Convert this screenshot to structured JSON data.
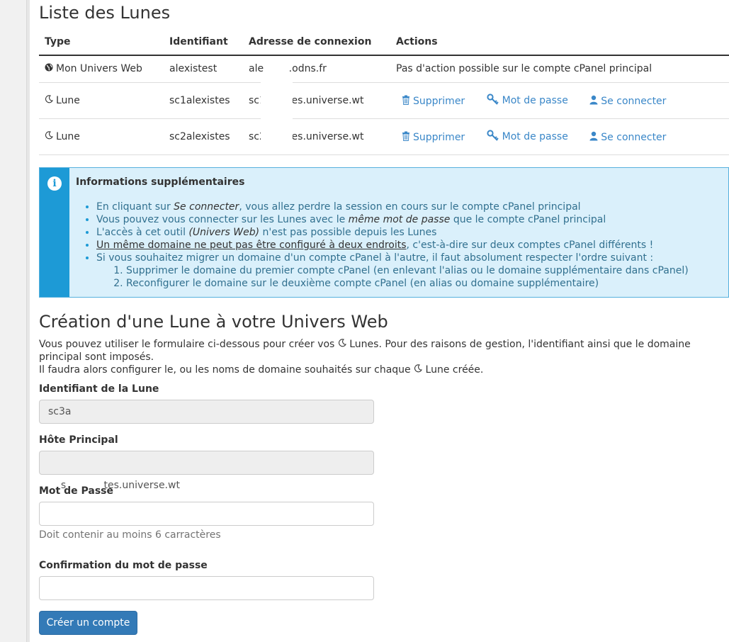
{
  "page": {
    "title": "Liste des Lunes"
  },
  "table": {
    "headers": [
      "Type",
      "Identifiant",
      "Adresse de connexion",
      "Actions"
    ],
    "main_row": {
      "type": "Mon Univers Web",
      "identifiant": "alexistest",
      "adresse": "ale        .odns.fr",
      "action_text": "Pas d'action possible sur le compte cPanel principal"
    },
    "rows": [
      {
        "type": "Lune",
        "identifiant": "sc1alexistes",
        "adresse": "sc1       tes.universe.wt"
      },
      {
        "type": "Lune",
        "identifiant": "sc2alexistes",
        "adresse": "sc2       tes.universe.wt"
      }
    ],
    "actions": {
      "delete": "Supprimer",
      "password": "Mot de passe",
      "login": "Se connecter"
    }
  },
  "info": {
    "title": "Informations supplémentaires",
    "item1_pre": "En cliquant sur ",
    "item1_em": "Se connecter",
    "item1_post": ", vous allez perdre la session en cours sur le compte cPanel principal",
    "item2_pre": "Vous pouvez vous connecter sur les Lunes avec le ",
    "item2_em": "même mot de passe",
    "item2_post": " que le compte cPanel principal",
    "item3_pre": "L'accès à cet outil ",
    "item3_em": "(Univers Web)",
    "item3_post": " n'est pas possible depuis les Lunes",
    "item4_u": "Un même domaine ne peut pas être configuré à deux endroits",
    "item4_post": ", c'est-à-dire sur deux comptes cPanel différents !",
    "item5": "Si vous souhaitez migrer un domaine d'un compte cPanel à l'autre, il faut absolument respecter l'ordre suivant :",
    "step1": "Supprimer le domaine du premier compte cPanel (en enlevant l'alias ou le domaine supplémentaire dans cPanel)",
    "step2": "Reconfigurer le domaine sur le deuxième compte cPanel (en alias ou domaine supplémentaire)"
  },
  "form": {
    "title": "Création d'une Lune à votre Univers Web",
    "desc1_pre": "Vous pouvez utiliser le formulaire ci-dessous pour créer vos ",
    "desc1_post": " Lunes. Pour des raisons de gestion, l'identifiant ainsi que le domaine principal sont imposés.",
    "desc2_pre": "Il faudra alors configurer le, ou les noms de domaine souhaités sur chaque ",
    "desc2_post": " Lune créée.",
    "id_label": "Identifiant de la Lune",
    "id_value": "sc3a",
    "host_label": "Hôte Principal",
    "host_value": "s            tes.universe.wt",
    "pwd_label": "Mot de Passe",
    "pwd_hint": "Doit contenir au moins 6 carractères",
    "confirm_label": "Confirmation du mot de passe",
    "submit": "Créer un compte"
  },
  "icons": {
    "main_type": "globe-icon",
    "lune_type": "moon-icon",
    "delete": "trash-icon",
    "password": "key-icon",
    "login": "user-icon",
    "info": "info-icon"
  },
  "colors": {
    "link": "#3a87c8",
    "info_bg": "#daf0fb",
    "info_side": "#1d9ad6",
    "info_text": "#31708f",
    "primary_button": "#337ab7"
  }
}
